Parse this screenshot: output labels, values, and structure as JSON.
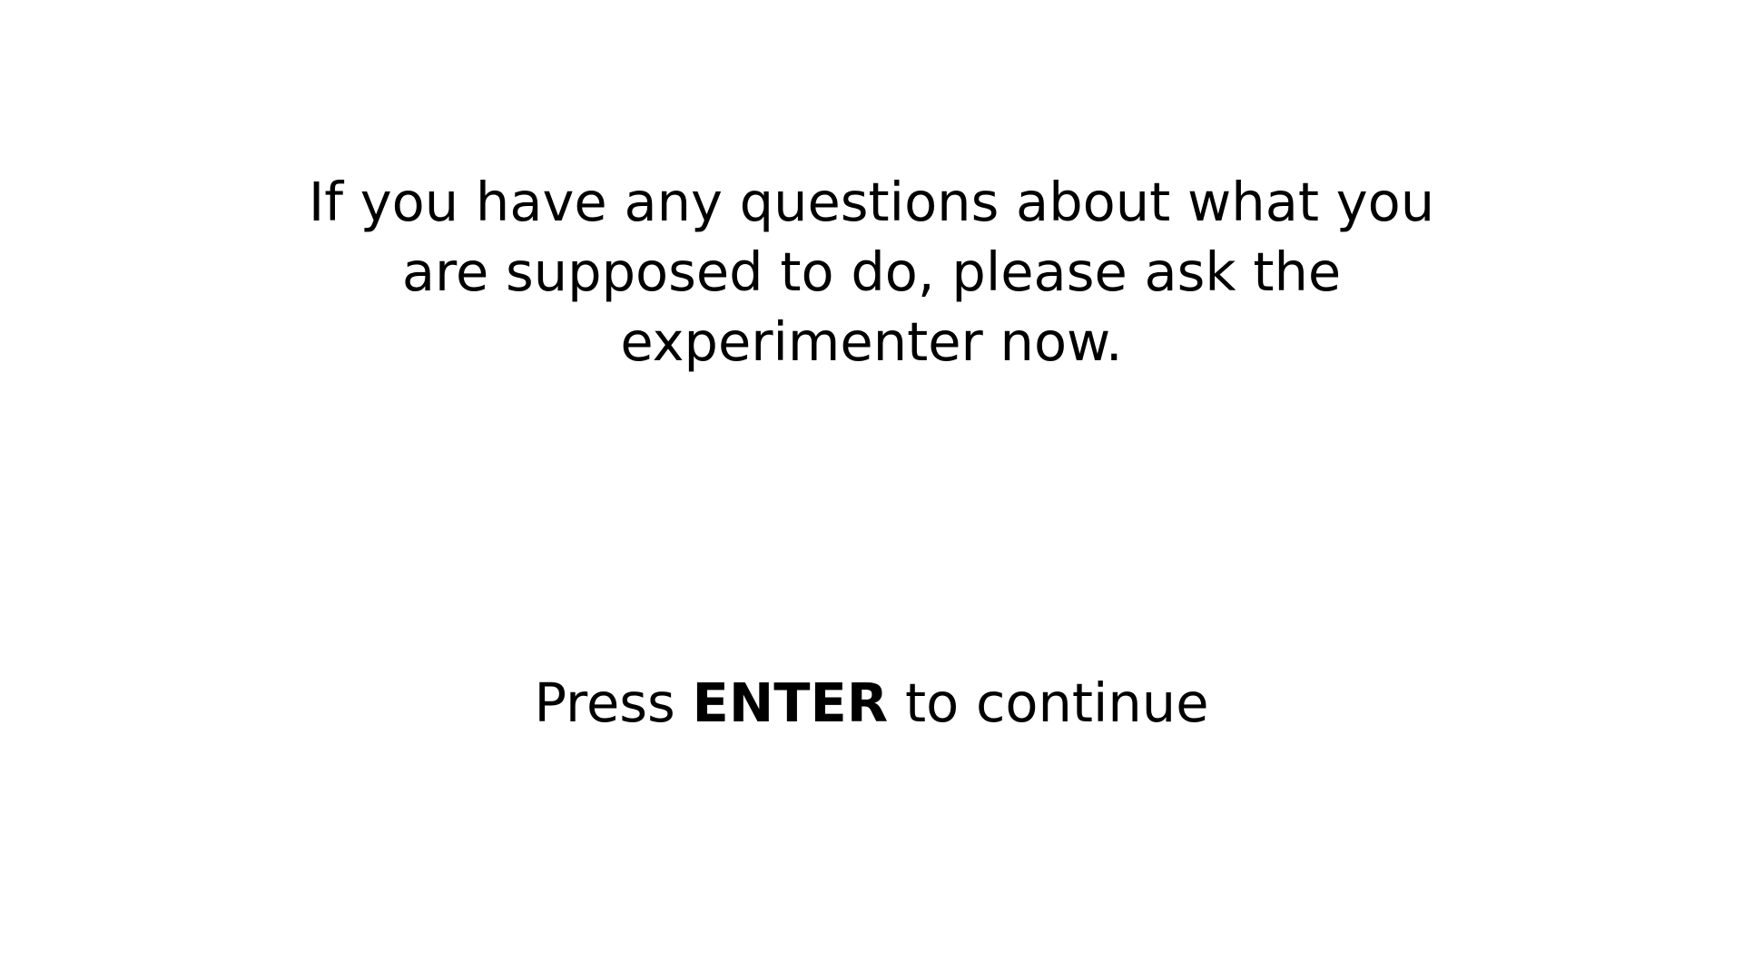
{
  "instructions": {
    "lines": [
      "If you have any questions about what you",
      "are supposed to do, please ask the",
      "experimenter now."
    ]
  },
  "continue_prompt": {
    "before": "Press ",
    "key": "ENTER",
    "after": " to continue"
  },
  "colors": {
    "background": "#ffffff",
    "text": "#000000"
  }
}
